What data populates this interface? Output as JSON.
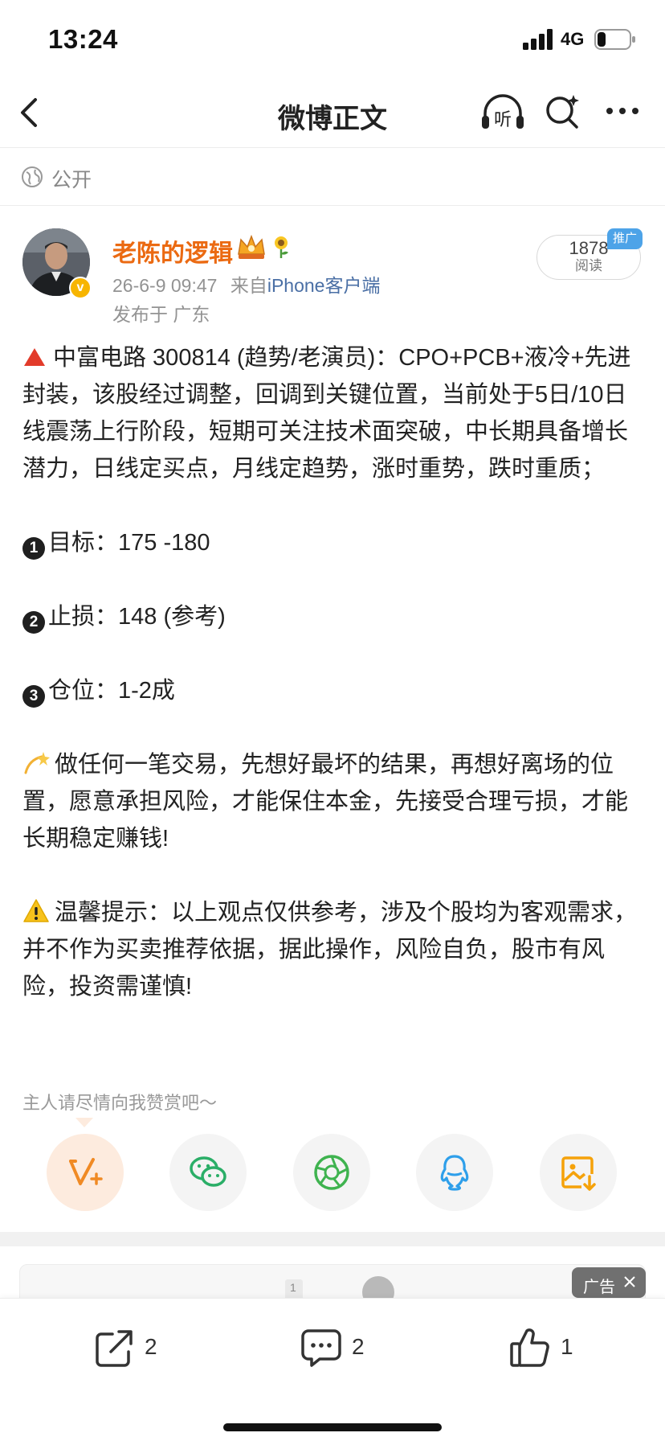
{
  "status_bar": {
    "time": "13:24",
    "network": "4G"
  },
  "nav": {
    "title": "微博正文",
    "listen_label": "听"
  },
  "visibility": {
    "label": "公开"
  },
  "author": {
    "name": "老陈的逻辑",
    "verified_badge": "v",
    "date": "26-6-9 09:47",
    "source_prefix": "来自",
    "source": "iPhone客户端",
    "location": "发布于 广东"
  },
  "stats_pill": {
    "read_count": "1878",
    "read_label": "阅读",
    "promo_tag": "推广"
  },
  "post": {
    "line1": "中富电路 300814 (趋势/老演员)：CPO+PCB+液冷+先进封装，该股经过调整，回调到关键位置，当前处于5日/10日线震荡上行阶段，短期可关注技术面突破，中长期具备增长潜力，日线定买点，月线定趋势，涨时重势，跌时重质；",
    "item1_num": "1",
    "item1": "目标：175 -180",
    "item2_num": "2",
    "item2": "止损：148 (参考)",
    "item3_num": "3",
    "item3": "仓位：1-2成",
    "advice": "做任何一笔交易，先想好最坏的结果，再想好离场的位置，愿意承担风险，才能保住本金，先接受合理亏损，才能长期稳定赚钱!",
    "disclaimer": "温馨提示：以上观点仅供参考，涉及个股均为客观需求，并不作为买卖推荐依据，据此操作，风险自负，股市有风险，投资需谨慎!"
  },
  "reward": {
    "hint": "主人请尽情向我赞赏吧～"
  },
  "share_targets": [
    "vplus-icon",
    "wechat-icon",
    "moments-icon",
    "qq-icon",
    "save-image-icon"
  ],
  "ad": {
    "label": "广告",
    "thumb_digit": "1"
  },
  "actions": {
    "repost_count": "2",
    "comment_count": "2",
    "like_count": "1"
  },
  "colors": {
    "author_name": "#eb6a12",
    "source_link": "#4a6fa5",
    "promo_tag": "#4da3e8",
    "verified": "#f7b500"
  }
}
